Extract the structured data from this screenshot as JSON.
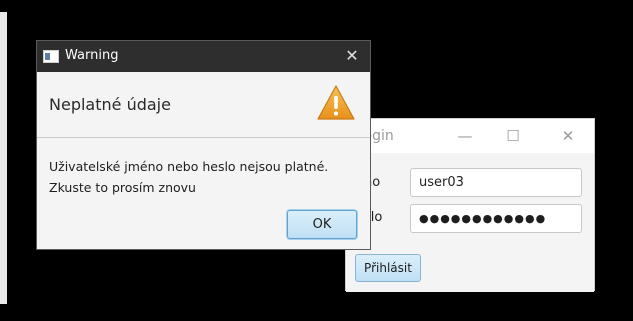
{
  "login_window": {
    "title": "Login",
    "min_glyph": "—",
    "max_glyph": "☐",
    "close_glyph": "✕",
    "username_label": "éno",
    "password_label": "eslo",
    "username_value": "user03",
    "password_value": "●●●●●●●●●●●●",
    "submit_label": "Přihlásit"
  },
  "warning_dialog": {
    "title": "Warning",
    "close_glyph": "✕",
    "header": "Neplatné údaje",
    "icon": "warning-triangle-icon",
    "message_line_1": "Uživatelské jméno nebo heslo nejsou platné.",
    "message_line_2": "Zkuste to prosím znovu",
    "ok_label": "OK"
  },
  "colors": {
    "desktop": "#000000",
    "dialog_titlebar": "#2e2e2e",
    "warning_fill": "#f0a42a",
    "button_blue": "#bfe0f4"
  }
}
